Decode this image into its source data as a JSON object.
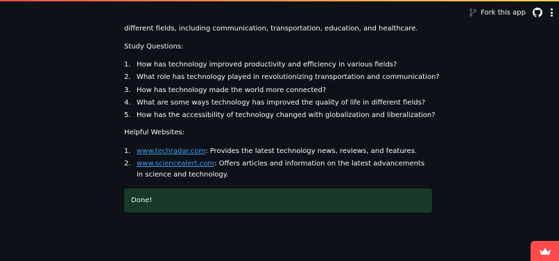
{
  "header": {
    "fork_label": "Fork this app",
    "icons": [
      "fork-icon",
      "github-icon",
      "more-vert-icon"
    ]
  },
  "content": {
    "intro_text": "different fields, including communication, transportation, education, and healthcare.",
    "study_heading": "Study Questions:",
    "questions": [
      {
        "num": "1.",
        "text": "How has technology improved productivity and efficiency in various fields?"
      },
      {
        "num": "2.",
        "text": "What role has technology played in revolutionizing transportation and communication?"
      },
      {
        "num": "3.",
        "text": "How has technology made the world more connected?"
      },
      {
        "num": "4.",
        "text": "What are some ways technology has improved the quality of life in different fields?"
      },
      {
        "num": "5.",
        "text": "How has the accessibility of technology changed with globalization and liberalization?"
      }
    ],
    "websites_heading": "Helpful Websites:",
    "websites": [
      {
        "num": "1.",
        "link": "www.techradar.com",
        "desc": ": Provides the latest technology news, reviews, and features."
      },
      {
        "num": "2.",
        "link": "www.sciencealert.com",
        "desc": ": Offers articles and information on the latest advancements in science and technology."
      }
    ]
  },
  "alert": {
    "text": "Done!"
  },
  "colors": {
    "background": "#0e1117",
    "text": "#fafafa",
    "link": "#3d9df3",
    "success_bg": "#173928",
    "accent": "#ff4b4b"
  }
}
